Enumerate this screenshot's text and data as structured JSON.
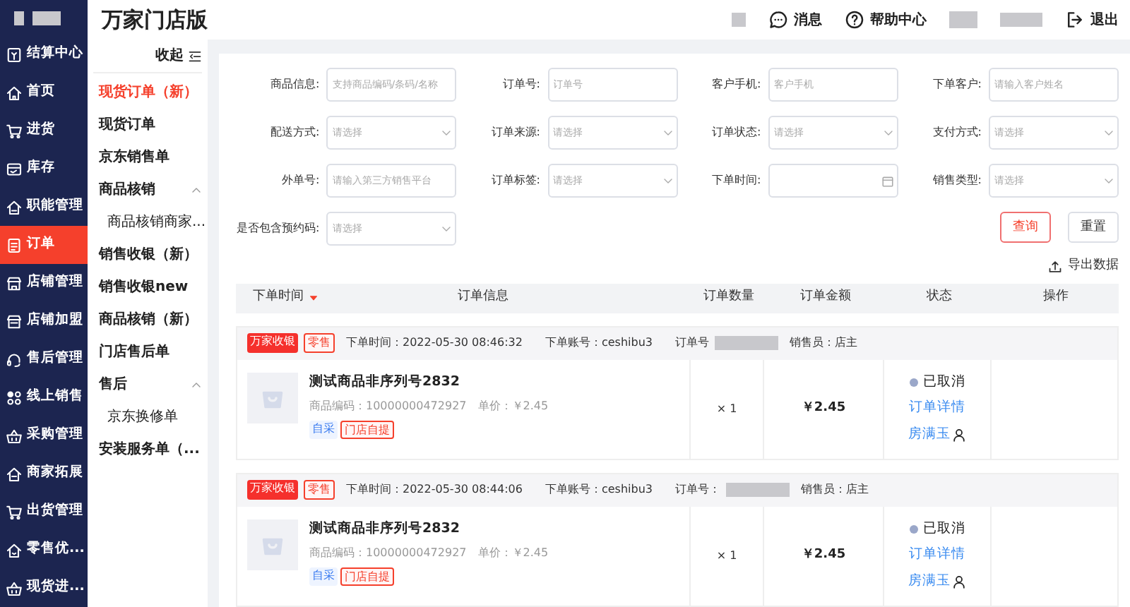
{
  "header": {
    "brand": "万家门店版",
    "actions": [
      {
        "label": "消息"
      },
      {
        "label": "帮助中心"
      },
      {
        "label": "退出"
      }
    ]
  },
  "sidebar": {
    "items": [
      {
        "label": "结算中心",
        "selected": false
      },
      {
        "label": "首页",
        "selected": false
      },
      {
        "label": "进货",
        "selected": false
      },
      {
        "label": "库存",
        "selected": false
      },
      {
        "label": "职能管理",
        "selected": false
      },
      {
        "label": "订单",
        "selected": true
      },
      {
        "label": "店铺管理",
        "selected": false
      },
      {
        "label": "店铺加盟",
        "selected": false
      },
      {
        "label": "售后管理",
        "selected": false
      },
      {
        "label": "线上销售",
        "selected": false
      },
      {
        "label": "采购管理",
        "selected": false
      },
      {
        "label": "商家拓展",
        "selected": false
      },
      {
        "label": "出货管理",
        "selected": false
      },
      {
        "label": "零售优...",
        "selected": false
      },
      {
        "label": "现货进...",
        "selected": false
      }
    ]
  },
  "subnav": {
    "collapse_label": "收起",
    "items": [
      {
        "label": "现货订单（新）",
        "selected": true
      },
      {
        "label": "现货订单",
        "selected": false
      },
      {
        "label": "京东销售单",
        "selected": false
      },
      {
        "label": "商品核销",
        "selected": false,
        "expanded": true,
        "children": [
          {
            "label": "商品核销商家...",
            "selected": false
          }
        ]
      },
      {
        "label": "销售收银（新）",
        "selected": false
      },
      {
        "label": "销售收银new",
        "selected": false
      },
      {
        "label": "商品核销（新）",
        "selected": false
      },
      {
        "label": "门店售后单",
        "selected": false
      },
      {
        "label": "售后",
        "selected": false,
        "expanded": true,
        "children": [
          {
            "label": "京东换修单",
            "selected": false
          }
        ]
      },
      {
        "label": "安装服务单（...",
        "selected": false
      }
    ]
  },
  "filters": [
    {
      "label": "商品信息:",
      "kind": "text",
      "placeholder": "支持商品编码/条码/名称"
    },
    {
      "label": "订单号:",
      "kind": "text",
      "placeholder": "订单号"
    },
    {
      "label": "客户手机:",
      "kind": "text",
      "placeholder": "客户手机"
    },
    {
      "label": "下单客户:",
      "kind": "text",
      "placeholder": "请输入客户姓名"
    },
    {
      "label": "配送方式:",
      "kind": "select",
      "placeholder": "请选择"
    },
    {
      "label": "订单来源:",
      "kind": "select",
      "placeholder": "请选择"
    },
    {
      "label": "订单状态:",
      "kind": "select",
      "placeholder": "请选择"
    },
    {
      "label": "支付方式:",
      "kind": "select",
      "placeholder": "请选择"
    },
    {
      "label": "外单号:",
      "kind": "text",
      "placeholder": "请输入第三方销售平台"
    },
    {
      "label": "订单标签:",
      "kind": "select",
      "placeholder": "请选择"
    },
    {
      "label": "下单时间:",
      "kind": "date"
    },
    {
      "label": "销售类型:",
      "kind": "select",
      "placeholder": "请选择"
    },
    {
      "label": "是否包含预约码:",
      "kind": "select",
      "placeholder": "请选择"
    }
  ],
  "buttons": [
    {
      "label": "查询",
      "kind": "primary"
    },
    {
      "label": "重置",
      "kind": "default"
    }
  ],
  "export_label": "导出数据",
  "table": {
    "columns": [
      {
        "label": "下单时间",
        "sortable": true
      },
      {
        "label": "订单信息",
        "sortable": false
      },
      {
        "label": "订单数量",
        "sortable": false
      },
      {
        "label": "订单金额",
        "sortable": false
      },
      {
        "label": "状态",
        "sortable": false
      },
      {
        "label": "操作",
        "sortable": false
      }
    ]
  },
  "orders": [
    {
      "tags": [
        {
          "label": "万家收银",
          "kind": "solid"
        },
        {
          "label": "零售",
          "kind": "outline"
        }
      ],
      "time": "下单时间：2022-05-30 08:46:32",
      "account": "下单账号：ceshibu3",
      "order_no_label": "订单号",
      "salesperson": "销售员：店主",
      "product": {
        "name": "测试商品非序列号2832",
        "code": "商品编码：10000000472927",
        "price": "单价：￥2.45",
        "tags": [
          {
            "label": "自采",
            "kind": "soft"
          },
          {
            "label": "门店自提",
            "kind": "outline"
          }
        ]
      },
      "quantity": "× 1",
      "amount": "￥2.45",
      "status": {
        "label": "已取消",
        "color": "#9aa7c9"
      },
      "detail_link": "订单详情",
      "operator": "房满玉"
    },
    {
      "tags": [
        {
          "label": "万家收银",
          "kind": "solid"
        },
        {
          "label": "零售",
          "kind": "outline"
        }
      ],
      "time": "下单时间：2022-05-30 08:44:06",
      "account": "下单账号：ceshibu3",
      "order_no_label": "订单号：",
      "salesperson": "销售员：店主",
      "product": {
        "name": "测试商品非序列号2832",
        "code": "商品编码：10000000472927",
        "price": "单价：￥2.45",
        "tags": [
          {
            "label": "自采",
            "kind": "soft"
          },
          {
            "label": "门店自提",
            "kind": "outline"
          }
        ]
      },
      "quantity": "× 1",
      "amount": "￥2.45",
      "status": {
        "label": "已取消",
        "color": "#9aa7c9"
      },
      "detail_link": "订单详情",
      "operator": "房满玉"
    }
  ]
}
